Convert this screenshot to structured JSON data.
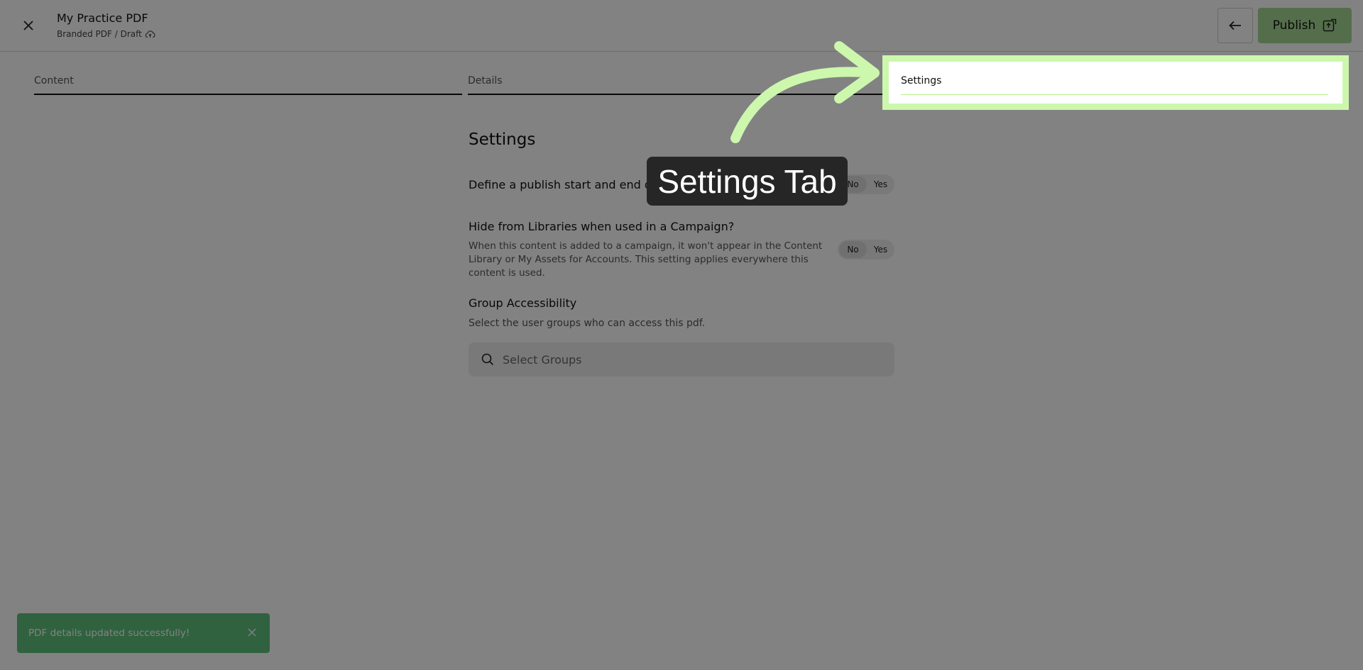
{
  "header": {
    "title": "My Practice PDF",
    "subtitle": "Branded PDF / Draft",
    "publish_label": "Publish"
  },
  "tabs": [
    {
      "label": "Content"
    },
    {
      "label": "Details"
    },
    {
      "label": "Settings"
    }
  ],
  "settings": {
    "title": "Settings",
    "publish_dates_label": "Define a publish start and end date?",
    "hide_label": "Hide from Libraries when used in a Campaign?",
    "hide_desc": "When this content is added to a campaign, it won't appear in the Content Library or My Assets for Accounts. This setting applies everywhere this content is used.",
    "toggle_no": "No",
    "toggle_yes": "Yes",
    "group_label": "Group Accessibility",
    "group_desc": "Select the user groups who can access this pdf.",
    "group_placeholder": "Select Groups"
  },
  "toast": {
    "message": "PDF details updated successfully!"
  },
  "annotation": {
    "tooltip": "Settings Tab"
  },
  "colors": {
    "accent": "#a6d894",
    "highlight": "#ccf7ad",
    "toast": "#5ec17c",
    "tooltip_bg": "#262626"
  }
}
